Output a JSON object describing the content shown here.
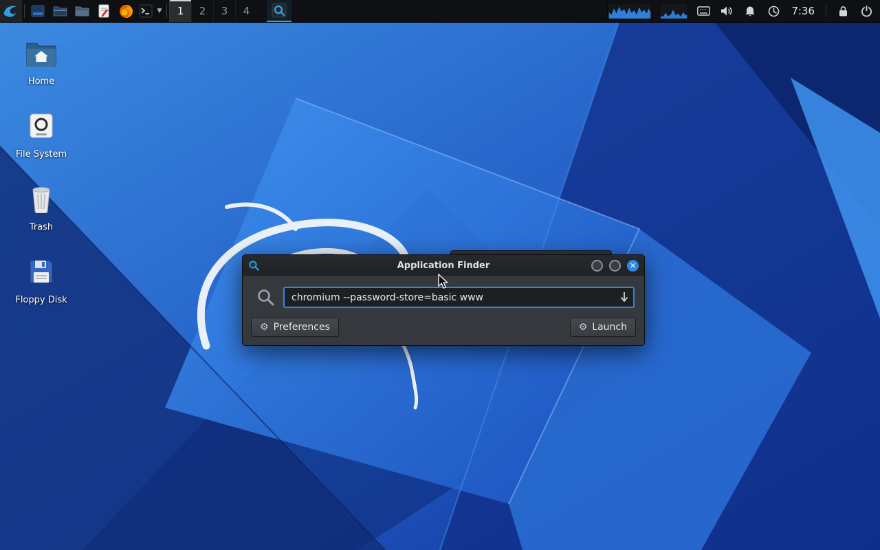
{
  "panel": {
    "workspaces": [
      "1",
      "2",
      "3",
      "4"
    ],
    "active_workspace": "1",
    "time": "7:36",
    "launcher_icons": [
      "kali-menu-icon",
      "files-icon",
      "file-manager-icon",
      "folder-icon",
      "text-editor-icon",
      "firefox-icon",
      "terminal-icon",
      "terminal-dropdown-chevron"
    ],
    "task_icon": "application-finder-icon",
    "tray_icons": [
      "cpu-graph",
      "network-graph",
      "keyboard-icon",
      "volume-icon",
      "notifications-bell-icon",
      "status-circle-icon",
      "lock-icon",
      "logout-icon"
    ]
  },
  "desktop": {
    "icons": [
      {
        "label": "Home",
        "icon": "home-icon"
      },
      {
        "label": "File System",
        "icon": "drive-icon"
      },
      {
        "label": "Trash",
        "icon": "trash-icon"
      },
      {
        "label": "Floppy Disk",
        "icon": "floppy-icon"
      }
    ]
  },
  "dialog": {
    "title": "Application Finder",
    "search_value": "chromium --password-store=basic www",
    "preferences_label": "Preferences",
    "launch_label": "Launch"
  },
  "colors": {
    "accent": "#2f86e8",
    "panel_bg": "#0e1013",
    "dialog_bg": "#35393d",
    "titlebar_bg": "#22252a",
    "entry_focus_border": "#3584e4",
    "wallpaper_base": "#2f7de0"
  }
}
